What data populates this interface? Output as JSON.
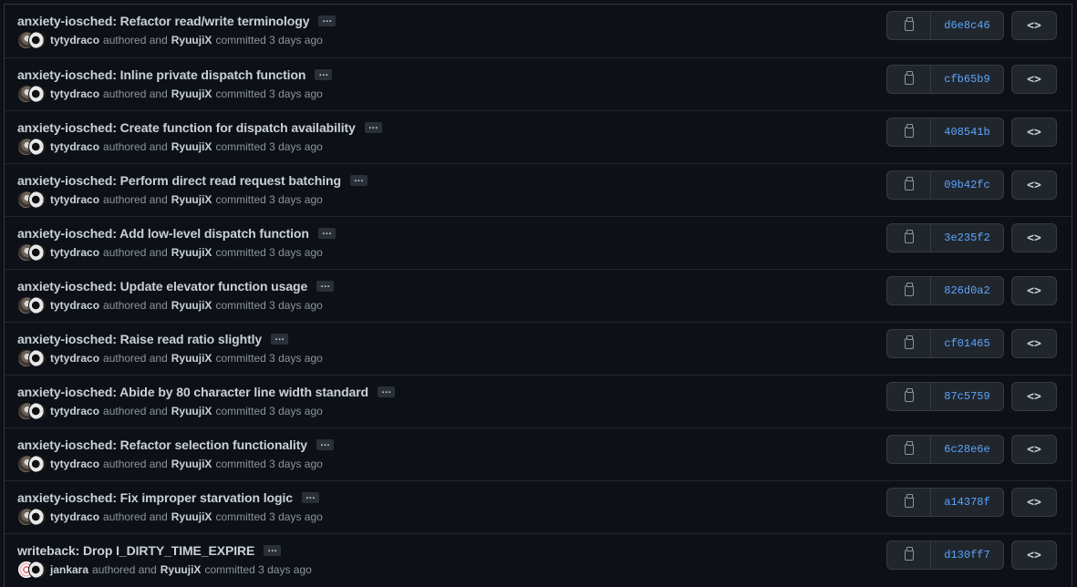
{
  "commits": [
    {
      "message": "anxiety-iosched: Refactor read/write terminology",
      "author": "tytydraco",
      "authored_text": "authored and",
      "committer": "RyuujiX",
      "committed_text": "committed 3 days ago",
      "sha": "d6e8c46",
      "ellipsis": "…"
    },
    {
      "message": "anxiety-iosched: Inline private dispatch function",
      "author": "tytydraco",
      "authored_text": "authored and",
      "committer": "RyuujiX",
      "committed_text": "committed 3 days ago",
      "sha": "cfb65b9",
      "ellipsis": "…"
    },
    {
      "message": "anxiety-iosched: Create function for dispatch availability",
      "author": "tytydraco",
      "authored_text": "authored and",
      "committer": "RyuujiX",
      "committed_text": "committed 3 days ago",
      "sha": "408541b",
      "ellipsis": "…"
    },
    {
      "message": "anxiety-iosched: Perform direct read request batching",
      "author": "tytydraco",
      "authored_text": "authored and",
      "committer": "RyuujiX",
      "committed_text": "committed 3 days ago",
      "sha": "09b42fc",
      "ellipsis": "…"
    },
    {
      "message": "anxiety-iosched: Add low-level dispatch function",
      "author": "tytydraco",
      "authored_text": "authored and",
      "committer": "RyuujiX",
      "committed_text": "committed 3 days ago",
      "sha": "3e235f2",
      "ellipsis": "…"
    },
    {
      "message": "anxiety-iosched: Update elevator function usage",
      "author": "tytydraco",
      "authored_text": "authored and",
      "committer": "RyuujiX",
      "committed_text": "committed 3 days ago",
      "sha": "826d0a2",
      "ellipsis": "…"
    },
    {
      "message": "anxiety-iosched: Raise read ratio slightly",
      "author": "tytydraco",
      "authored_text": "authored and",
      "committer": "RyuujiX",
      "committed_text": "committed 3 days ago",
      "sha": "cf01465",
      "ellipsis": "…"
    },
    {
      "message": "anxiety-iosched: Abide by 80 character line width standard",
      "author": "tytydraco",
      "authored_text": "authored and",
      "committer": "RyuujiX",
      "committed_text": "committed 3 days ago",
      "sha": "87c5759",
      "ellipsis": "…"
    },
    {
      "message": "anxiety-iosched: Refactor selection functionality",
      "author": "tytydraco",
      "authored_text": "authored and",
      "committer": "RyuujiX",
      "committed_text": "committed 3 days ago",
      "sha": "6c28e6e",
      "ellipsis": "…"
    },
    {
      "message": "anxiety-iosched: Fix improper starvation logic",
      "author": "tytydraco",
      "authored_text": "authored and",
      "committer": "RyuujiX",
      "committed_text": "committed 3 days ago",
      "sha": "a14378f",
      "ellipsis": "…"
    },
    {
      "message": "writeback: Drop I_DIRTY_TIME_EXPIRE",
      "author": "jankara",
      "authored_text": "authored and",
      "committer": "RyuujiX",
      "committed_text": "committed 3 days ago",
      "sha": "d130ff7",
      "ellipsis": "…"
    }
  ],
  "icons": {
    "copy": "clipboard-icon",
    "browse": "code-icon",
    "browse_glyph": "<>"
  },
  "colors": {
    "background": "#0d1117",
    "sha_link": "#58a6ff",
    "text": "#c9d1d9",
    "muted": "#8b949e"
  }
}
